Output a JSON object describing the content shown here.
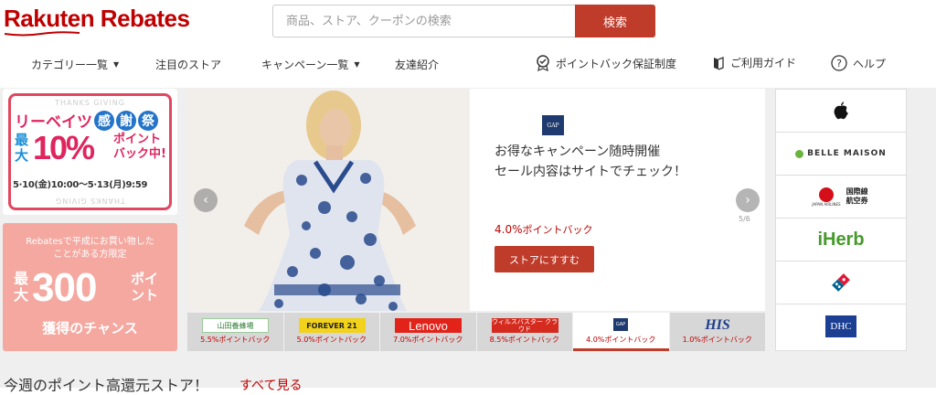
{
  "header": {
    "logo": "Rakuten Rebates",
    "search_placeholder": "商品、ストア、クーポンの検索",
    "search_button": "検索"
  },
  "nav": {
    "categories": "カテゴリー一覧",
    "featured": "注目のストア",
    "campaigns": "キャンペーン一覧",
    "referral": "友達紹介",
    "guarantee": "ポイントバック保証制度",
    "guide": "ご利用ガイド",
    "help": "ヘルプ"
  },
  "banner1": {
    "top_text": "THANKS GIVING",
    "title_prefix": "リーベイツ",
    "title_chars": [
      "感",
      "謝",
      "祭"
    ],
    "max": "最大",
    "percent": "10%",
    "point": "ポイント\nバック中!",
    "date": "5·10(金)10:00〜5·13(月)9:59"
  },
  "banner2": {
    "line1": "Rebatesで平成にお買い物した",
    "line2": "ことがある方限定",
    "max": "最大",
    "number": "300",
    "point": "ポイ\nント",
    "chance": "獲得のチャンス"
  },
  "carousel": {
    "store_logo": "GAP",
    "line1": "お得なキャンペーン随時開催",
    "line2": "セール内容はサイトでチェック！",
    "pct": "4.0%",
    "pct_suffix": "ポイントバック",
    "button": "ストアにすすむ",
    "pager": "5/6"
  },
  "tabs": [
    {
      "logo": "山田養蜂場",
      "label": "5.5%ポイントバック"
    },
    {
      "logo": "FOREVER 21",
      "label": "5.0%ポイントバック"
    },
    {
      "logo": "Lenovo",
      "label": "7.0%ポイントバック"
    },
    {
      "logo": "ウィルスバスター クラウド",
      "label": "8.5%ポイントバック"
    },
    {
      "logo": "GAP",
      "label": "4.0%ポイントバック"
    },
    {
      "logo": "HIS",
      "label": "1.0%ポイントバック"
    }
  ],
  "stores": [
    {
      "name": "apple-logo"
    },
    {
      "name": "BELLE MAISON"
    },
    {
      "name": "国際線 航空券",
      "brand": "JAPAN AIRLINES"
    },
    {
      "name": "iHerb"
    },
    {
      "name": "domino-logo"
    },
    {
      "name": "DHC"
    }
  ],
  "bottom": {
    "title": "今週のポイント高還元ストア！",
    "link": "すべて見る"
  },
  "colors": {
    "brand": "#bf0000",
    "button": "#bf3b2a"
  }
}
